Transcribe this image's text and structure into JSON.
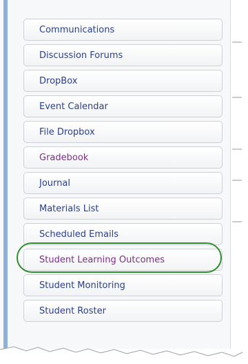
{
  "menu": {
    "items": [
      {
        "label": "Communications",
        "color": "#2b3f8c"
      },
      {
        "label": "Discussion Forums",
        "color": "#2b3f8c"
      },
      {
        "label": "DropBox",
        "color": "#2b3f8c"
      },
      {
        "label": "Event Calendar",
        "color": "#2b3f8c"
      },
      {
        "label": "File Dropbox",
        "color": "#2b3f8c"
      },
      {
        "label": "Gradebook",
        "color": "#7a2f86"
      },
      {
        "label": "Journal",
        "color": "#2b3f8c"
      },
      {
        "label": "Materials List",
        "color": "#2b3f8c"
      },
      {
        "label": "Scheduled Emails",
        "color": "#2b3f8c"
      },
      {
        "label": "Student Learning Outcomes",
        "color": "#7a2f86",
        "highlighted": true
      },
      {
        "label": "Student Monitoring",
        "color": "#2b3f8c"
      },
      {
        "label": "Student Roster",
        "color": "#2b3f8c"
      }
    ]
  },
  "highlight_color": "#2f8f2f",
  "accent_bar_color": "#8fb0d6"
}
